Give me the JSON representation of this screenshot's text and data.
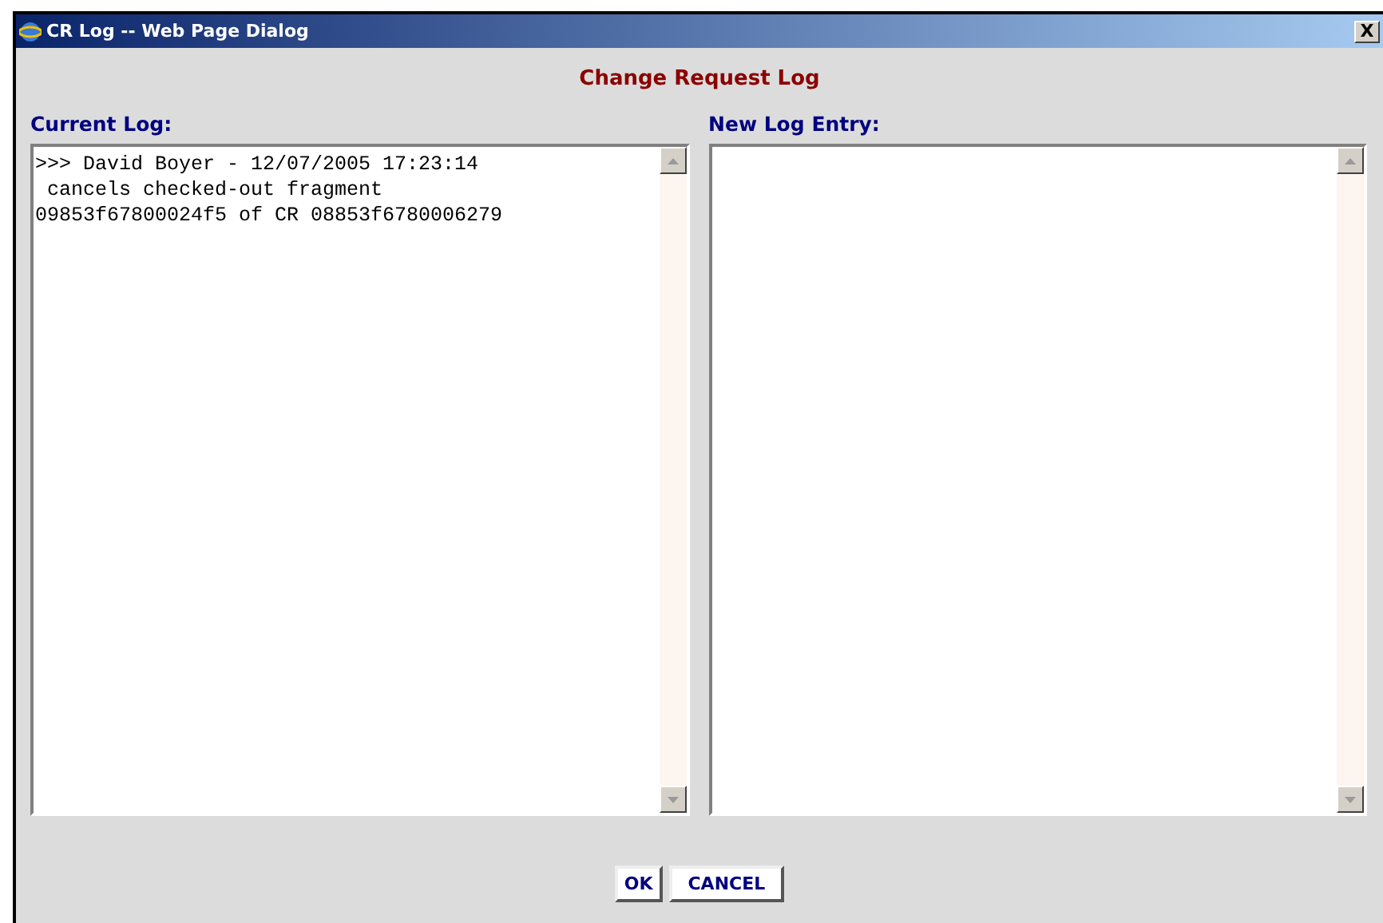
{
  "window": {
    "title": "CR Log -- Web Page Dialog",
    "close": "X"
  },
  "heading": "Change Request Log",
  "current_log": {
    "label": "Current Log:",
    "lines": [
      ">>> David Boyer - 12/07/2005 17:23:14",
      " cancels checked-out fragment",
      "09853f67800024f5 of CR 08853f6780006279"
    ]
  },
  "new_log_entry": {
    "label": "New Log Entry:"
  },
  "buttons": [
    "OK",
    "CANCEL"
  ]
}
